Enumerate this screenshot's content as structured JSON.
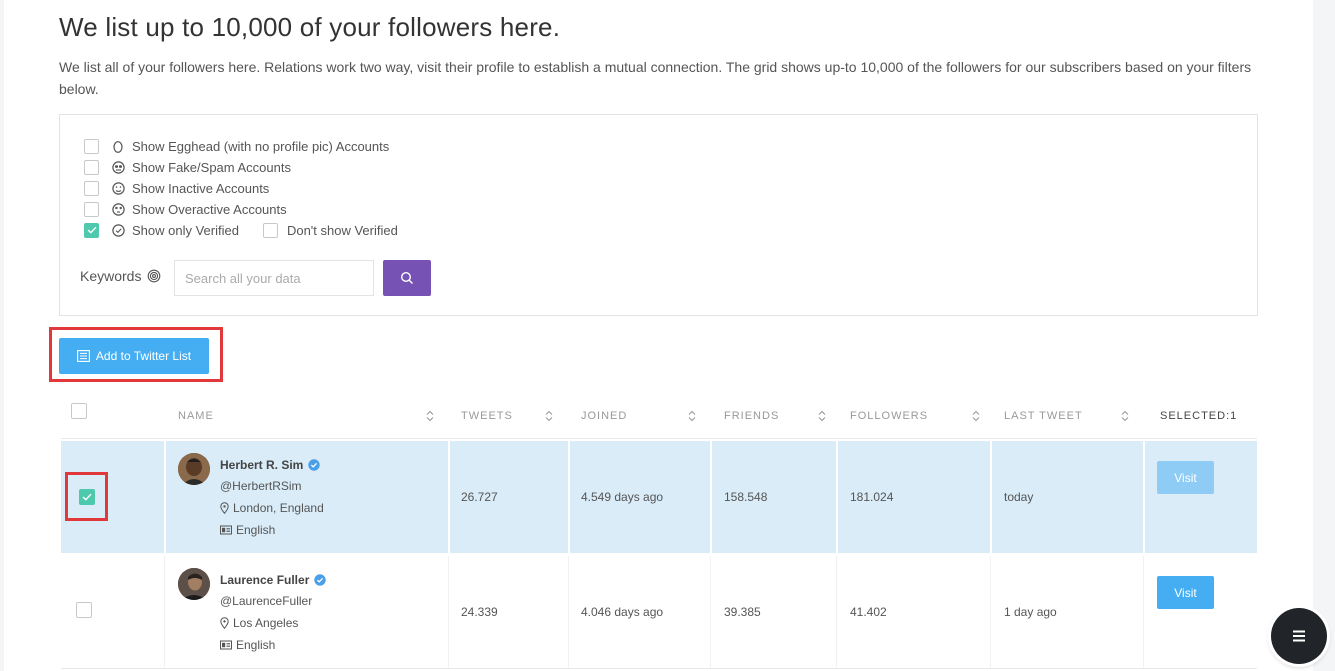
{
  "header": {
    "title": "We list up to 10,000 of your followers here.",
    "description": "We list all of your followers here. Relations work two way, visit their profile to establish a mutual connection. The grid shows up-to 10,000 of the followers for our subscribers based on your filters below."
  },
  "filters": {
    "egghead": "Show Egghead (with no profile pic) Accounts",
    "fake": "Show Fake/Spam Accounts",
    "inactive": "Show Inactive Accounts",
    "overactive": "Show Overactive Accounts",
    "verified": "Show only Verified",
    "dont_verified": "Don't show Verified",
    "verified_checked": true
  },
  "keywords": {
    "label": "Keywords",
    "placeholder": "Search all your data"
  },
  "actions": {
    "add_to_list": "Add to Twitter List"
  },
  "table": {
    "columns": {
      "name": "NAME",
      "tweets": "TWEETS",
      "joined": "JOINED",
      "friends": "FRIENDS",
      "followers": "FOLLOWERS",
      "last_tweet": "LAST TWEET",
      "selected": "SELECTED:1"
    },
    "rows": [
      {
        "name": "Herbert R. Sim",
        "handle": "@HerbertRSim",
        "location": "London, England",
        "language": "English",
        "tweets": "26.727",
        "joined": "4.549 days ago",
        "friends": "158.548",
        "followers": "181.024",
        "last_tweet": "today",
        "visit": "Visit",
        "selected": true
      },
      {
        "name": "Laurence Fuller",
        "handle": "@LaurenceFuller",
        "location": "Los Angeles",
        "language": "English",
        "tweets": "24.339",
        "joined": "4.046 days ago",
        "friends": "39.385",
        "followers": "41.402",
        "last_tweet": "1 day ago",
        "visit": "Visit",
        "selected": false
      }
    ]
  },
  "colors": {
    "accent_blue": "#45aef2",
    "accent_purple": "#7752b5",
    "check_green": "#4fc9ae",
    "selected_row": "#d9ecf8",
    "highlight_red": "#e0383b"
  }
}
